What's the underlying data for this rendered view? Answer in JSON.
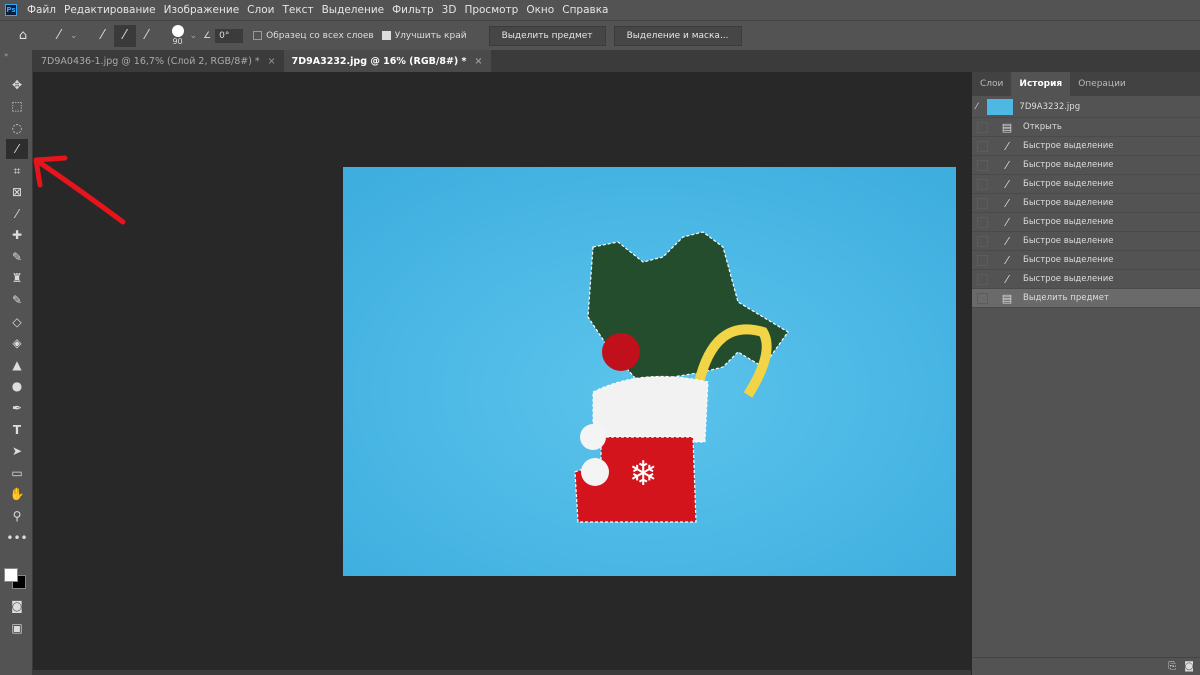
{
  "app": {
    "logo": "Ps"
  },
  "menu": [
    "Файл",
    "Редактирование",
    "Изображение",
    "Слои",
    "Текст",
    "Выделение",
    "Фильтр",
    "3D",
    "Просмотр",
    "Окно",
    "Справка"
  ],
  "options": {
    "brush_size": "90",
    "angle": "0°",
    "sample_all_layers": "Образец со всех слоев",
    "sample_all_layers_checked": false,
    "enhance_edge": "Улучшить край",
    "enhance_edge_checked": true,
    "select_subject": "Выделить предмет",
    "select_and_mask": "Выделение и маска..."
  },
  "tabs": [
    {
      "label": "7D9A0436-1.jpg @ 16,7% (Слой 2, RGB/8#) *",
      "active": false
    },
    {
      "label": "7D9A3232.jpg @ 16% (RGB/8#) *",
      "active": true
    }
  ],
  "panel": {
    "tabs": [
      "Слои",
      "История",
      "Операции"
    ],
    "active_tab": "История",
    "snapshot": "7D9A3232.jpg",
    "history": [
      {
        "label": "Открыть",
        "icon": "document-icon"
      },
      {
        "label": "Быстрое выделение",
        "icon": "quick-selection-icon"
      },
      {
        "label": "Быстрое выделение",
        "icon": "quick-selection-icon"
      },
      {
        "label": "Быстрое выделение",
        "icon": "quick-selection-icon"
      },
      {
        "label": "Быстрое выделение",
        "icon": "quick-selection-icon"
      },
      {
        "label": "Быстрое выделение",
        "icon": "quick-selection-icon"
      },
      {
        "label": "Быстрое выделение",
        "icon": "quick-selection-icon"
      },
      {
        "label": "Быстрое выделение",
        "icon": "quick-selection-icon"
      },
      {
        "label": "Быстрое выделение",
        "icon": "quick-selection-icon"
      },
      {
        "label": "Выделить предмет",
        "icon": "document-icon",
        "selected": true
      }
    ]
  },
  "colors": {
    "image_bg": "#4fb7e4",
    "annotation_arrow": "#e8141c"
  }
}
